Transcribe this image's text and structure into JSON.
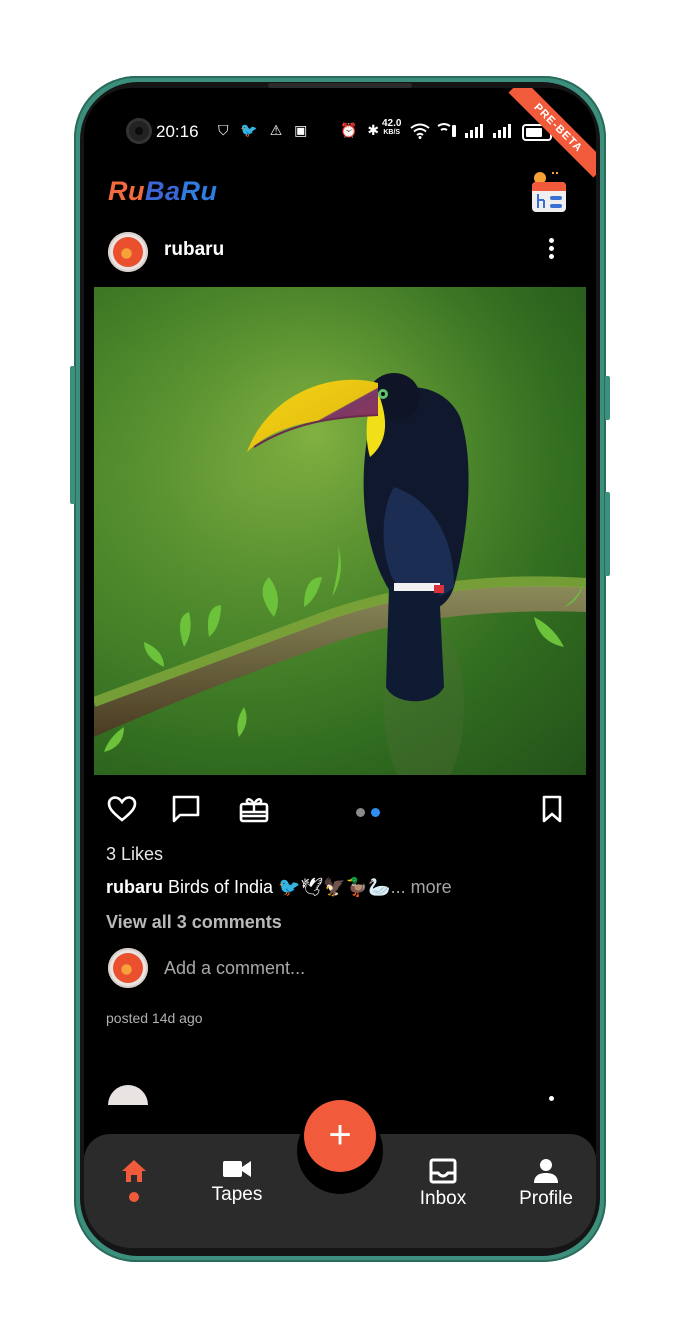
{
  "status_bar": {
    "time": "20:16",
    "left_icons": "⛉ 🐦 ⚠ ▣",
    "network_speed_value": "42.0",
    "network_speed_unit": "KB/S",
    "right_icons": "⏰ ✱ ≋ ☏ ▂▄▆ ▂▄▆"
  },
  "ribbon": {
    "label": "PRE-BETA"
  },
  "app": {
    "logo": {
      "part1": "Ru",
      "part2": "Ba",
      "part3": "Ru"
    }
  },
  "post": {
    "username": "rubaru",
    "likes": "3 Likes",
    "caption_user": "rubaru",
    "caption_text": " Birds of India 🐦🕊🦅🦆🦢",
    "caption_more": "... more",
    "view_comments": "View all 3 comments",
    "comment_placeholder": "Add a comment...",
    "posted": "posted 14d ago",
    "image_subject": "toucan on mossy branch",
    "carousel": {
      "count": 2,
      "active_index": 1
    }
  },
  "bottom_nav": {
    "fab_label": "+",
    "items": [
      {
        "label": "",
        "icon": "home-icon",
        "active": true
      },
      {
        "label": "Tapes",
        "icon": "video-camera-icon"
      },
      {
        "label": "Inbox",
        "icon": "inbox-icon"
      },
      {
        "label": "Profile",
        "icon": "person-icon"
      }
    ]
  },
  "colors": {
    "accent": "#f15a3a",
    "carousel_active": "#2f8ff0",
    "carousel_inactive": "#8a8a8a",
    "nav_background": "#2b2b2b",
    "phone_frame": "#3c8f7c"
  }
}
